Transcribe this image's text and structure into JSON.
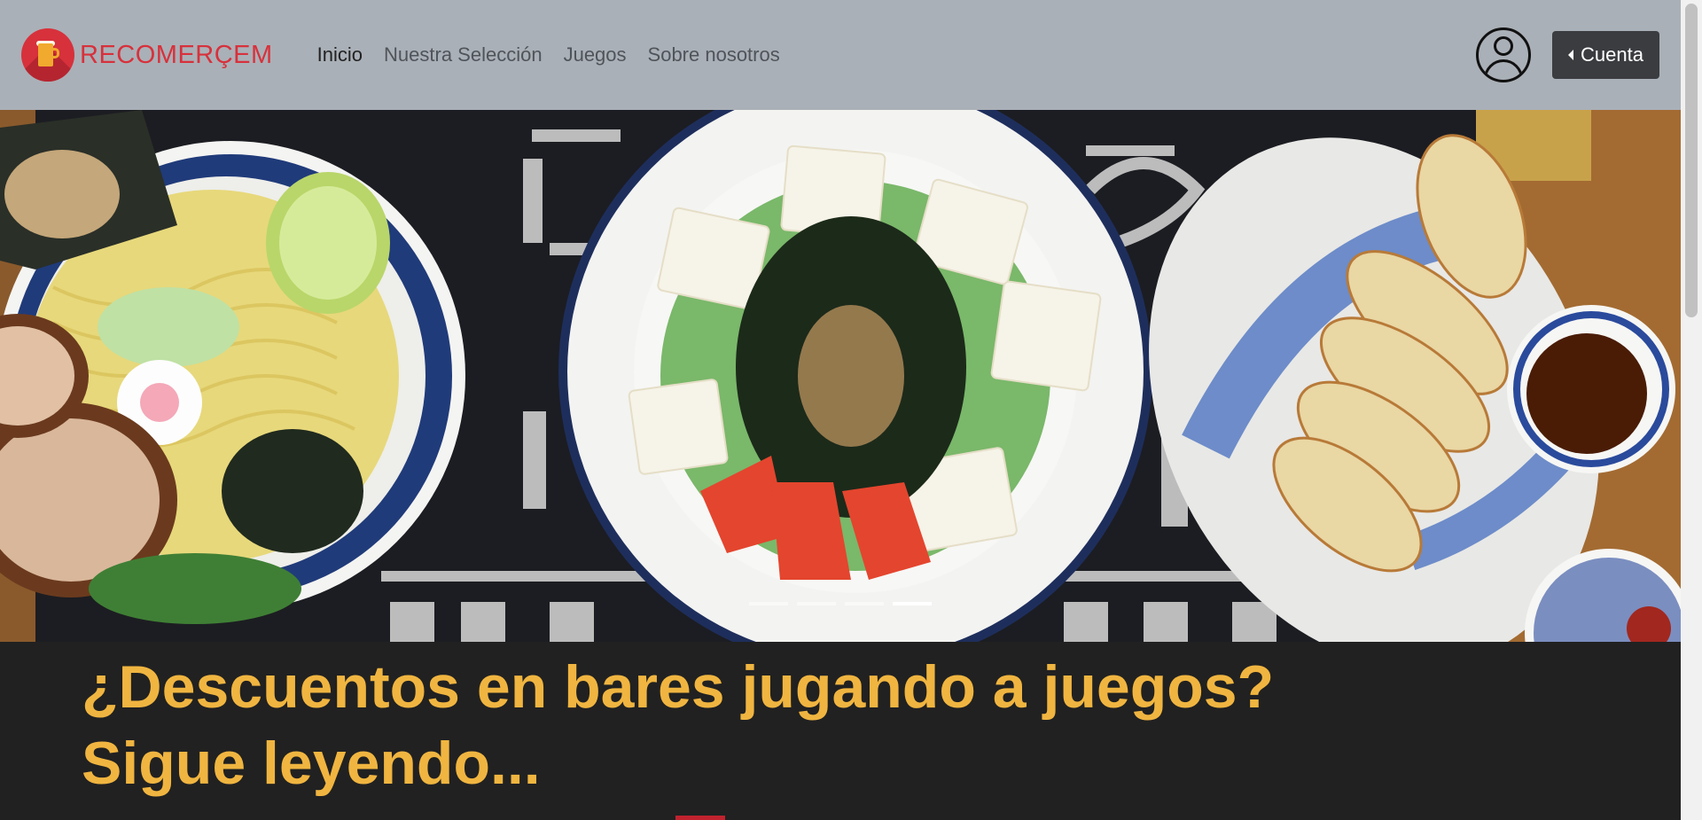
{
  "brand": {
    "name": "RECOMERÇEM",
    "logo_icon": "beer-mug-icon"
  },
  "nav": {
    "items": [
      {
        "label": "Inicio",
        "active": true
      },
      {
        "label": "Nuestra Selección",
        "active": false
      },
      {
        "label": "Juegos",
        "active": false
      },
      {
        "label": "Sobre nosotros",
        "active": false
      }
    ]
  },
  "header": {
    "profile_icon": "user-profile-icon",
    "account_label": "Cuenta"
  },
  "carousel": {
    "image": "ramen-tofu-salad-gyoza-photo",
    "slides": 4,
    "active_slide": 4
  },
  "headline": {
    "text": "¿Descuentos en bares jugando a juegos? Sigue leyendo..."
  },
  "colors": {
    "navbar_bg": "#aab0b7",
    "brand_red": "#d7313c",
    "headline_yellow": "#f0b540",
    "page_bg": "#212121"
  }
}
